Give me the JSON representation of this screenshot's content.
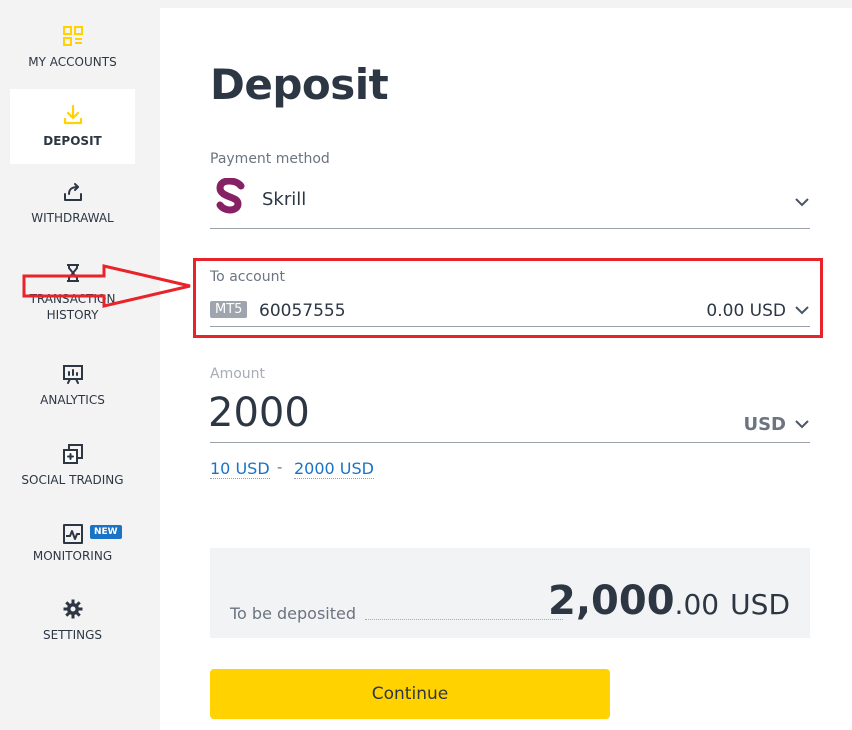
{
  "sidebar": {
    "items": [
      {
        "label": "MY ACCOUNTS",
        "icon": "grid-list-icon"
      },
      {
        "label": "DEPOSIT",
        "icon": "download-icon"
      },
      {
        "label": "WITHDRAWAL",
        "icon": "upload-icon"
      },
      {
        "label": "TRANSACTION HISTORY",
        "line1": "TRANSACTION",
        "line2": "HISTORY",
        "icon": "hourglass-icon"
      },
      {
        "label": "ANALYTICS",
        "icon": "presentation-chart-icon"
      },
      {
        "label": "SOCIAL TRADING",
        "icon": "social-trading-icon"
      },
      {
        "label": "MONITORING",
        "icon": "pulse-chart-icon",
        "badge": "NEW"
      },
      {
        "label": "SETTINGS",
        "icon": "gear-icon"
      }
    ]
  },
  "page": {
    "title": "Deposit"
  },
  "payment_method": {
    "label": "Payment method",
    "value": "Skrill",
    "logo": "S"
  },
  "to_account": {
    "label": "To account",
    "platform": "MT5",
    "account_number": "60057555",
    "balance": "0.00 USD"
  },
  "amount": {
    "label": "Amount",
    "value": "2000",
    "currency": "USD",
    "min": "10 USD",
    "max": "2000 USD",
    "separator": "-"
  },
  "summary": {
    "label": "To be deposited",
    "amount_whole": "2,000",
    "amount_fraction": ".00",
    "currency": "USD"
  },
  "actions": {
    "continue_label": "Continue"
  },
  "colors": {
    "accent": "#ffd200",
    "link": "#1a73c7",
    "annotation": "#e8232a",
    "skrill": "#862165"
  }
}
